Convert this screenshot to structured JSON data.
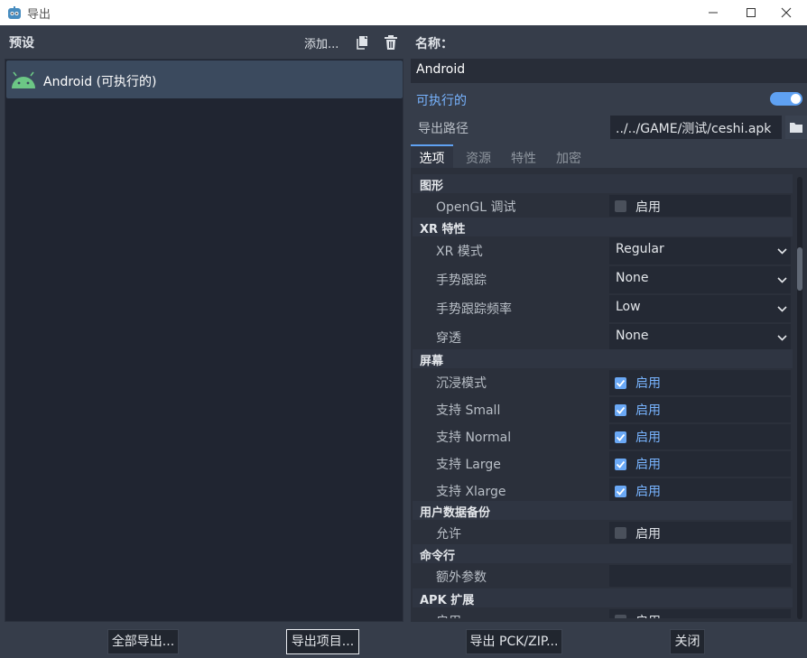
{
  "window": {
    "title": "导出",
    "icon": "godot-icon",
    "controls": [
      "minimize-icon",
      "maximize-icon",
      "close-icon"
    ]
  },
  "presets": {
    "header": "预设",
    "add_label": "添加...",
    "duplicate_icon": "duplicate-icon",
    "delete_icon": "trash-icon",
    "items": [
      {
        "label": "Android (可执行的)",
        "icon": "android-icon",
        "selected": true
      }
    ]
  },
  "details": {
    "name_label": "名称：",
    "name_value": "Android",
    "runnable_label": "可执行的",
    "runnable_on": true,
    "export_path_label": "导出路径",
    "export_path_value": "../../GAME/测试/ceshi.apk",
    "tabs": [
      "选项",
      "资源",
      "特性",
      "加密"
    ],
    "active_tab": "选项"
  },
  "options": {
    "enable_label": "启用",
    "sections": {
      "graphics": "图形",
      "xr": "XR 特性",
      "screen": "屏幕",
      "backup": "用户数据备份",
      "command_line": "命令行",
      "apk": "APK 扩展"
    },
    "props": {
      "opengl_debug": {
        "name": "OpenGL 调试",
        "checked": false
      },
      "xr_mode": {
        "name": "XR 模式",
        "value": "Regular"
      },
      "hand_tracking": {
        "name": "手势跟踪",
        "value": "None"
      },
      "hand_tracking_freq": {
        "name": "手势跟踪频率",
        "value": "Low"
      },
      "passthrough": {
        "name": "穿透",
        "value": "None"
      },
      "immersive": {
        "name": "沉浸模式",
        "checked": true
      },
      "support_small": {
        "name": "支持 Small",
        "checked": true
      },
      "support_normal": {
        "name": "支持 Normal",
        "checked": true
      },
      "support_large": {
        "name": "支持 Large",
        "checked": true
      },
      "support_xlarge": {
        "name": "支持 Xlarge",
        "checked": true
      },
      "allow_backup": {
        "name": "允许",
        "checked": false
      },
      "extra_args": {
        "name": "额外参数",
        "value": ""
      },
      "apk_enable": {
        "name": "启用",
        "checked": false
      }
    }
  },
  "footer": {
    "export_all": "全部导出...",
    "export_project": "导出项目...",
    "export_pck": "导出 PCK/ZIP...",
    "close": "关闭"
  },
  "colors": {
    "accent": "#5fa1f2",
    "accent_text": "#78b4ff",
    "background": "#363d4a",
    "selection": "#3b4a5e"
  }
}
